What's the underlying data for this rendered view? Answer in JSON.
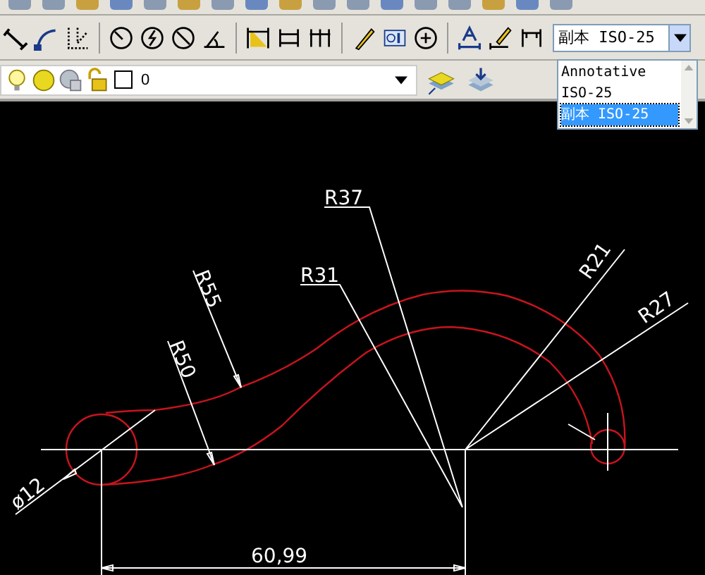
{
  "dim_style_dropdown": {
    "value": "副本 ISO-25",
    "options": [
      {
        "label": "Annotative",
        "selected": false
      },
      {
        "label": "ISO-25",
        "selected": false
      },
      {
        "label": "副本 ISO-25",
        "selected": true
      }
    ]
  },
  "layer_bar": {
    "layer_name": "0"
  },
  "drawing": {
    "labels": [
      {
        "text": "R37"
      },
      {
        "text": "R31"
      },
      {
        "text": "R55"
      },
      {
        "text": "R50"
      },
      {
        "text": "R21"
      },
      {
        "text": "R27"
      },
      {
        "text": "ø12"
      },
      {
        "text": "60,99"
      }
    ]
  }
}
